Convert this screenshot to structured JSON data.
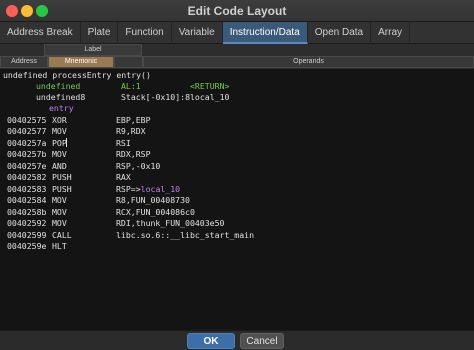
{
  "window": {
    "title": "Edit Code Layout"
  },
  "tabs": [
    {
      "label": "Address Break"
    },
    {
      "label": "Plate"
    },
    {
      "label": "Function"
    },
    {
      "label": "Variable"
    },
    {
      "label": "Instruction/Data"
    },
    {
      "label": "Open Data"
    },
    {
      "label": "Array"
    }
  ],
  "active_tab": "Instruction/Data",
  "field_header": {
    "label": "Label",
    "address": "Address",
    "mnemonic": "Mnemonic",
    "operands": "Operands"
  },
  "listing": {
    "signature": "undefined processEntry entry()",
    "vars": [
      {
        "type": "undefined",
        "storage": "AL:1",
        "name": "<RETURN>"
      },
      {
        "type": "undefined8",
        "storage": "Stack[-0x10]:8",
        "name": "local_10"
      }
    ],
    "label": "entry",
    "instructions": [
      {
        "addr": "00402575",
        "mnem": "XOR",
        "ops": "EBP,EBP"
      },
      {
        "addr": "00402577",
        "mnem": "MOV",
        "ops": "R9,RDX"
      },
      {
        "addr": "0040257a",
        "mnem": "POP",
        "ops": "RSI"
      },
      {
        "addr": "0040257b",
        "mnem": "MOV",
        "ops": "RDX,RSP"
      },
      {
        "addr": "0040257e",
        "mnem": "AND",
        "ops": "RSP,-0x10"
      },
      {
        "addr": "00402582",
        "mnem": "PUSH",
        "ops": "RAX"
      },
      {
        "addr": "00402583",
        "mnem": "PUSH",
        "ops": "RSP=>local_10"
      },
      {
        "addr": "00402584",
        "mnem": "MOV",
        "ops": "R8,FUN_00408730"
      },
      {
        "addr": "0040258b",
        "mnem": "MOV",
        "ops": "RCX,FUN_004086c0"
      },
      {
        "addr": "00402592",
        "mnem": "MOV",
        "ops": "RDI,thunk_FUN_00403e50"
      },
      {
        "addr": "00402599",
        "mnem": "CALL",
        "ops": "libc.so.6::__libc_start_main"
      },
      {
        "addr": "0040259e",
        "mnem": "HLT",
        "ops": ""
      }
    ]
  },
  "buttons": {
    "ok": "OK",
    "cancel": "Cancel"
  },
  "colors": {
    "active_tab": "#3a5a7a",
    "mnemonic_header": "#9a7a52",
    "return_label": "#78c850",
    "local_ref": "#c080e8",
    "ok_button": "#3d6ea8"
  }
}
